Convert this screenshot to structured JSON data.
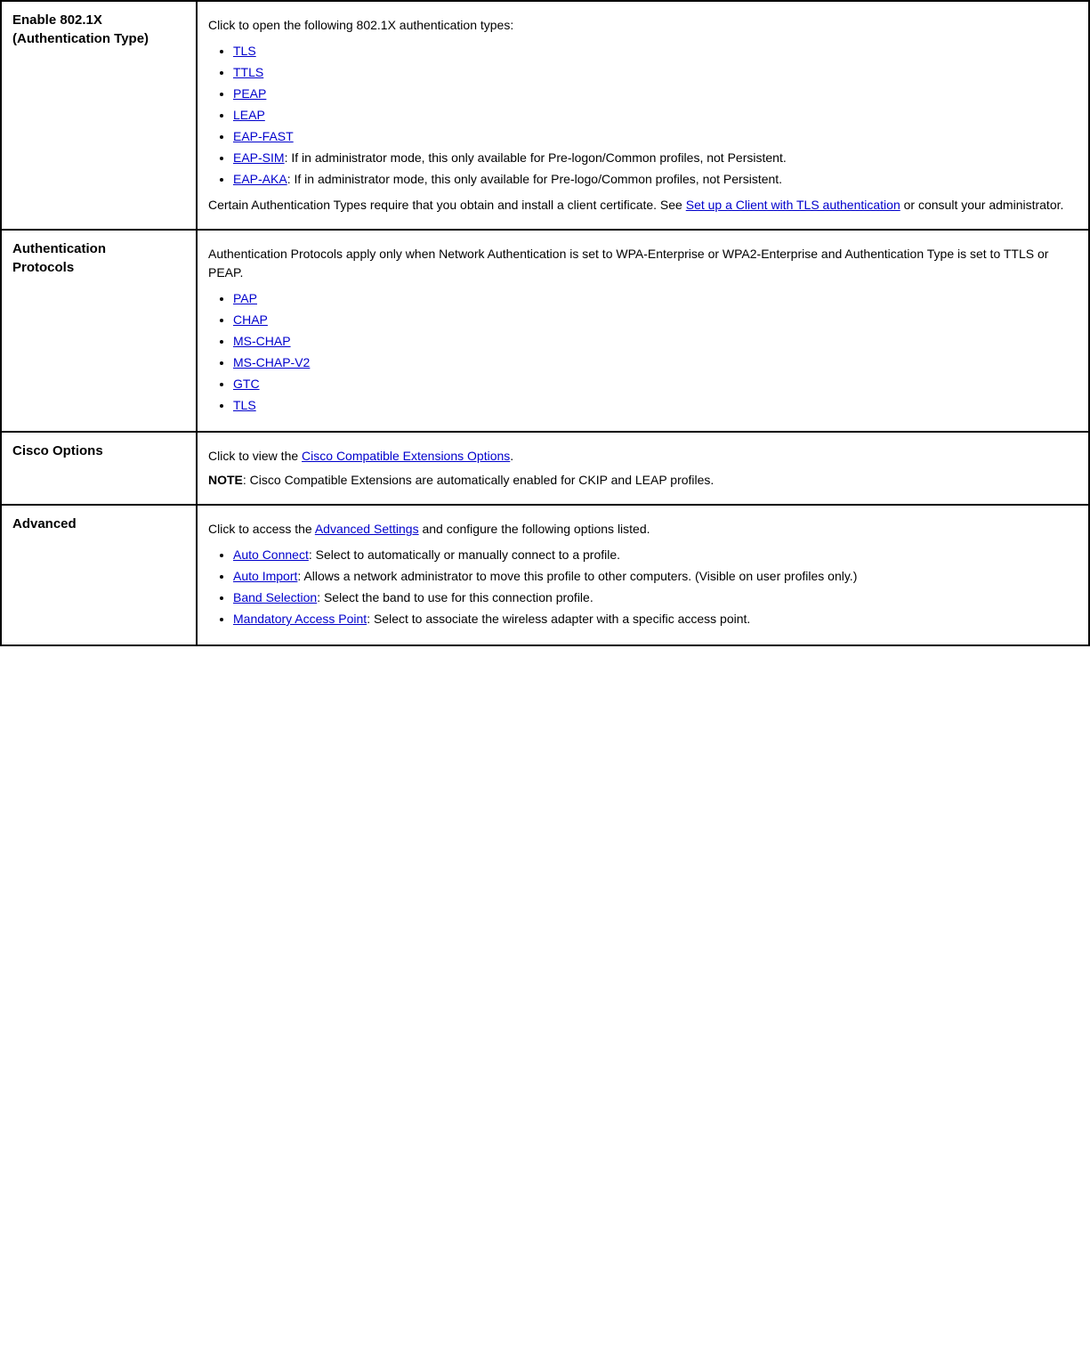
{
  "rows": [
    {
      "id": "enable-802-1x",
      "label": "Enable 802.1X\n(Authentication Type)",
      "content": {
        "intro": "Click to open the following 802.1X authentication types:",
        "list": [
          {
            "text": "TLS",
            "link": true
          },
          {
            "text": "TTLS",
            "link": true
          },
          {
            "text": "PEAP",
            "link": true
          },
          {
            "text": "LEAP",
            "link": true
          },
          {
            "text": "EAP-FAST",
            "link": true
          },
          {
            "text": "EAP-SIM",
            "link": true,
            "suffix": ": If in administrator mode, this only available for Pre-logon/Common profiles, not Persistent."
          },
          {
            "text": "EAP-AKA",
            "link": true,
            "suffix": ": If in administrator mode, this only available for Pre-logo/Common profiles, not Persistent."
          }
        ],
        "footer_text": "Certain Authentication Types require that you obtain and install a client certificate. See ",
        "footer_link": "Set up a Client with TLS authentication",
        "footer_end": " or consult your administrator."
      }
    },
    {
      "id": "authentication-protocols",
      "label": "Authentication\nProtocols",
      "content": {
        "intro": "Authentication Protocols apply only when Network Authentication is set to WPA-Enterprise or WPA2-Enterprise and Authentication Type is set to TTLS or PEAP.",
        "list": [
          {
            "text": "PAP",
            "link": true
          },
          {
            "text": "CHAP",
            "link": true
          },
          {
            "text": "MS-CHAP",
            "link": true
          },
          {
            "text": "MS-CHAP-V2",
            "link": true
          },
          {
            "text": "GTC",
            "link": true
          },
          {
            "text": "TLS",
            "link": true
          }
        ]
      }
    },
    {
      "id": "cisco-options",
      "label": "Cisco Options",
      "content": {
        "intro": "Click to view the ",
        "intro_link": "Cisco Compatible Extensions Options",
        "intro_end": ".",
        "note_label": "NOTE",
        "note_text": ": Cisco Compatible Extensions are automatically enabled for CKIP and LEAP profiles."
      }
    },
    {
      "id": "advanced",
      "label": "Advanced",
      "content": {
        "intro": "Click to access the ",
        "intro_link": "Advanced Settings",
        "intro_end": " and configure the following options listed.",
        "list": [
          {
            "text": "Auto Connect",
            "link": true,
            "suffix": ": Select to automatically or manually connect to a profile."
          },
          {
            "text": "Auto Import",
            "link": true,
            "suffix": ": Allows a network administrator to move this profile to other computers. (Visible on user profiles only.)"
          },
          {
            "text": "Band Selection",
            "link": true,
            "suffix": ": Select the band to use for this connection profile."
          },
          {
            "text": "Mandatory Access Point",
            "link": true,
            "suffix": ": Select to associate the wireless adapter with a specific access point."
          }
        ]
      }
    }
  ]
}
